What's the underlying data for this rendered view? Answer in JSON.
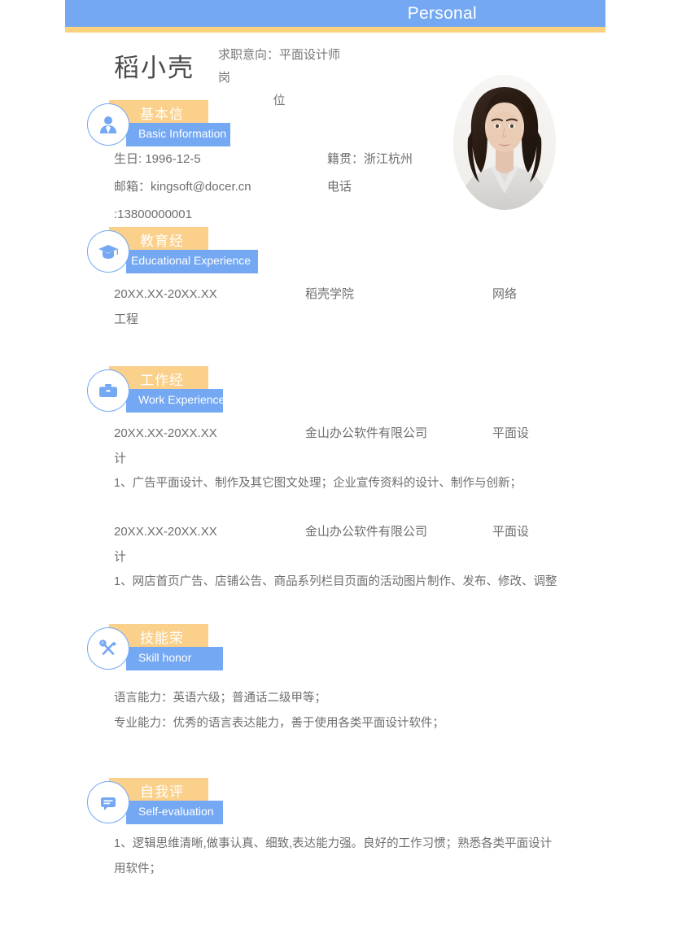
{
  "header": {
    "title": "Personal",
    "bar_color": "#74A8F2",
    "stripe_color": "#FCD27C"
  },
  "profile": {
    "name": "稻小壳",
    "objective_line1": "求职意向：平面设计师岗",
    "objective_line2": "位",
    "photo_alt": "portrait-photo"
  },
  "sections": [
    {
      "icon": "person-icon",
      "cn": "基本信",
      "en": "Basic Information",
      "en_width": 128
    },
    {
      "icon": "graduation-cap-icon",
      "cn": "教育经",
      "en": "Educational Experience",
      "en_width": 162
    },
    {
      "icon": "briefcase-icon",
      "cn": "工作经",
      "en": "Work Experience",
      "en_width": 119
    },
    {
      "icon": "tools-icon",
      "cn": "技能荣",
      "en": "Skill  honor",
      "en_width": 119
    },
    {
      "icon": "chat-bubble-icon",
      "cn": "自我评",
      "en": "Self-evaluation",
      "en_width": 119
    }
  ],
  "basic_info": {
    "birthday": "生日: 1996-12-5",
    "hometown": "籍贯：浙江杭州",
    "email": "邮箱：kingsoft@docer.cn",
    "phone_label": "电话",
    "phone_value": ":13800000001"
  },
  "education": {
    "date": "20XX.XX-20XX.XX",
    "school": "稻壳学院",
    "major": "网络",
    "major_wrap": "工程"
  },
  "work": [
    {
      "date": "20XX.XX-20XX.XX",
      "company": "金山办公软件有限公司",
      "role": "平面设",
      "role_wrap": "计",
      "bullet": "1、广告平面设计、制作及其它图文处理；企业宣传资料的设计、制作与创新；"
    },
    {
      "date": "20XX.XX-20XX.XX",
      "company": "金山办公软件有限公司",
      "role": "平面设",
      "role_wrap": "计",
      "bullet": "1、网店首页广告、店铺公告、商品系列栏目页面的活动图片制作、发布、修改、调整"
    }
  ],
  "skills": {
    "line1": "语言能力：英语六级；普通话二级甲等；",
    "line2": "专业能力：优秀的语言表达能力，善于使用各类平面设计软件；"
  },
  "self_evaluation": {
    "line1": "1、逻辑思维清晰,做事认真、细致,表达能力强。良好的工作习惯；熟悉各类平面设计",
    "line2": "用软件；"
  }
}
